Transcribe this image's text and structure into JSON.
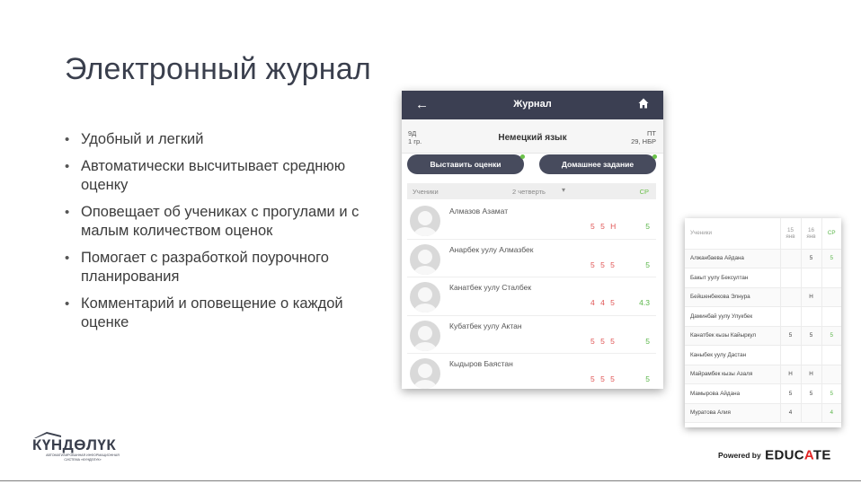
{
  "slide": {
    "title": "Электронный журнал",
    "bullets": [
      "Удобный и легкий",
      "Автоматически высчитывает среднюю оценку",
      "Оповещает об учениках с прогулами и с малым количеством оценок",
      "Помогает с разработкой поурочного планирования",
      "Комментарий и оповещение о каждой оценке"
    ]
  },
  "phone": {
    "appbar": {
      "back_icon": "←",
      "title": "Журнал",
      "home_icon": "home-icon"
    },
    "class_line1": "9Д",
    "class_line2": "1 гр.",
    "subject": "Немецкий язык",
    "day": "ПТ",
    "date": "29, НБР",
    "btn_grades": "Выставить оценки",
    "btn_homework": "Домашнее задание",
    "header": {
      "students": "Ученики",
      "quarter": "2 четверть",
      "caret": "▾",
      "avg": "СР"
    },
    "students": [
      {
        "name": "Алмазов Азамат",
        "grades": "5 5 Н",
        "avg": "5"
      },
      {
        "name": "Анарбек уулу Алмазбек",
        "grades": "5 5 5",
        "avg": "5"
      },
      {
        "name": "Канатбек уулу Сталбек",
        "grades": "4 4 5",
        "avg": "4.3"
      },
      {
        "name": "Кубатбек уулу Актан",
        "grades": "5 5 5",
        "avg": "5"
      },
      {
        "name": "Кыдыров Баястан",
        "grades": "5 5 5",
        "avg": "5"
      }
    ]
  },
  "table": {
    "head": {
      "students": "Ученики",
      "d1": "15",
      "d1m": "янв",
      "d2": "16",
      "d2m": "янв",
      "avg": "СР"
    },
    "rows": [
      {
        "name": "Алжанбаева Айдана",
        "c1": "",
        "c2": "5",
        "cp": "5"
      },
      {
        "name": "Бакыт уулу Бексултан",
        "c1": "",
        "c2": "",
        "cp": ""
      },
      {
        "name": "Бейшенбекова Элнура",
        "c1": "",
        "c2": "Н",
        "cp": ""
      },
      {
        "name": "Даминбай уулу Улукбек",
        "c1": "",
        "c2": "",
        "cp": ""
      },
      {
        "name": "Канатбек кызы Кайыркул",
        "c1": "5",
        "c2": "5",
        "cp": "5"
      },
      {
        "name": "Каныбек уулу Дастан",
        "c1": "",
        "c2": "",
        "cp": ""
      },
      {
        "name": "Майрамбек кызы Азаля",
        "c1": "Н",
        "c2": "Н",
        "cp": ""
      },
      {
        "name": "Мамырова Айдана",
        "c1": "5",
        "c2": "5",
        "cp": "5"
      },
      {
        "name": "Муратова Алия",
        "c1": "4",
        "c2": "",
        "cp": "4"
      }
    ]
  },
  "logo": {
    "word": "КҮНДӨЛҮК",
    "sub1": "АВТОМАТИЗИРОВАННАЯ ИНФОРМАЦИОННАЯ",
    "sub2": "СИСТЕМА «КУНДЕЛУК»"
  },
  "powered": {
    "prefix": "Powered by",
    "brand_a": "EDUC",
    "brand_b": "A",
    "brand_c": "TE"
  },
  "colors": {
    "appbar": "#3b3f52",
    "accent_green": "#5bb64a",
    "grade_red": "#e05555",
    "brand_red": "#e32424"
  }
}
